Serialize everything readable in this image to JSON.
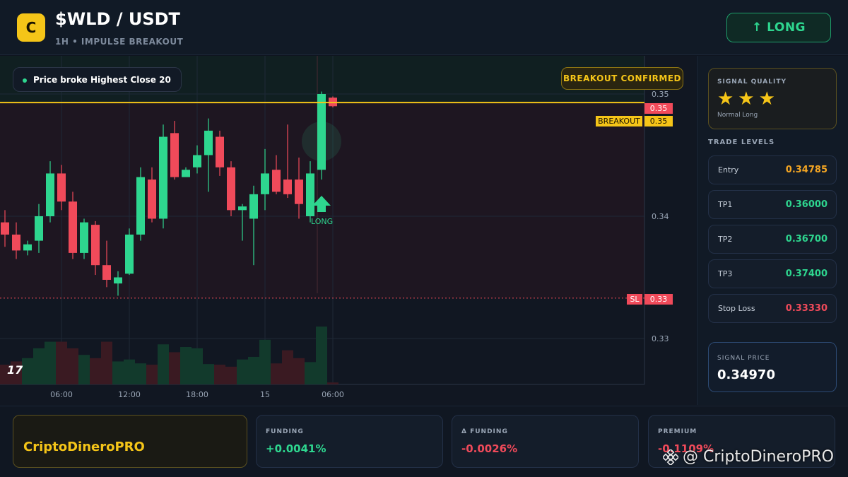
{
  "header": {
    "logo_letter": "C",
    "pair": "$WLD / USDT",
    "subtitle": "1H • IMPULSE BREAKOUT",
    "long_button": "↑ LONG"
  },
  "chart": {
    "pill_text": "Price broke Highest Close 20",
    "confirm_badge": "BREAKOUT CONFIRMED",
    "tv_logo": "17",
    "long_marker": "LONG",
    "breakout_tag": "BREAKOUT",
    "breakout_value": "0.35",
    "last_price_tag": "0.35",
    "sl_tag": "SL",
    "sl_value": "0.33",
    "y_ticks": [
      "0.35",
      "0.34",
      "0.33"
    ],
    "x_ticks": [
      "06:00",
      "12:00",
      "18:00",
      "15",
      "06:00"
    ]
  },
  "chart_data": {
    "type": "candlestick",
    "ylim": [
      0.3285,
      0.3555
    ],
    "y_ticks": [
      0.35,
      0.34,
      0.33
    ],
    "breakout_level": 0.3493,
    "stop_loss_level": 0.3333,
    "candles": [
      {
        "o": 0.3395,
        "h": 0.3405,
        "l": 0.3375,
        "c": 0.3385
      },
      {
        "o": 0.3385,
        "h": 0.3395,
        "l": 0.3365,
        "c": 0.3372
      },
      {
        "o": 0.3372,
        "h": 0.338,
        "l": 0.3368,
        "c": 0.3377
      },
      {
        "o": 0.338,
        "h": 0.341,
        "l": 0.337,
        "c": 0.34
      },
      {
        "o": 0.34,
        "h": 0.3445,
        "l": 0.3395,
        "c": 0.3435
      },
      {
        "o": 0.3435,
        "h": 0.3442,
        "l": 0.3405,
        "c": 0.3412
      },
      {
        "o": 0.3412,
        "h": 0.342,
        "l": 0.3365,
        "c": 0.337
      },
      {
        "o": 0.337,
        "h": 0.3398,
        "l": 0.3365,
        "c": 0.3395
      },
      {
        "o": 0.3393,
        "h": 0.3396,
        "l": 0.3352,
        "c": 0.336
      },
      {
        "o": 0.336,
        "h": 0.338,
        "l": 0.3342,
        "c": 0.3348
      },
      {
        "o": 0.3345,
        "h": 0.3355,
        "l": 0.3335,
        "c": 0.335
      },
      {
        "o": 0.3353,
        "h": 0.339,
        "l": 0.3352,
        "c": 0.3385
      },
      {
        "o": 0.3385,
        "h": 0.344,
        "l": 0.338,
        "c": 0.3432
      },
      {
        "o": 0.343,
        "h": 0.344,
        "l": 0.3395,
        "c": 0.3398
      },
      {
        "o": 0.3398,
        "h": 0.3475,
        "l": 0.339,
        "c": 0.3465
      },
      {
        "o": 0.3468,
        "h": 0.3478,
        "l": 0.343,
        "c": 0.3432
      },
      {
        "o": 0.3432,
        "h": 0.344,
        "l": 0.3433,
        "c": 0.3438
      },
      {
        "o": 0.344,
        "h": 0.3458,
        "l": 0.3435,
        "c": 0.345
      },
      {
        "o": 0.345,
        "h": 0.348,
        "l": 0.342,
        "c": 0.347
      },
      {
        "o": 0.3465,
        "h": 0.347,
        "l": 0.3433,
        "c": 0.344
      },
      {
        "o": 0.344,
        "h": 0.3445,
        "l": 0.34,
        "c": 0.3405
      },
      {
        "o": 0.3405,
        "h": 0.341,
        "l": 0.338,
        "c": 0.3408
      },
      {
        "o": 0.3398,
        "h": 0.3425,
        "l": 0.336,
        "c": 0.3418
      },
      {
        "o": 0.3418,
        "h": 0.3455,
        "l": 0.3405,
        "c": 0.3435
      },
      {
        "o": 0.3438,
        "h": 0.345,
        "l": 0.3418,
        "c": 0.342
      },
      {
        "o": 0.343,
        "h": 0.3475,
        "l": 0.3415,
        "c": 0.3418
      },
      {
        "o": 0.343,
        "h": 0.3448,
        "l": 0.3398,
        "c": 0.341
      },
      {
        "o": 0.34,
        "h": 0.3445,
        "l": 0.3395,
        "c": 0.3435
      },
      {
        "o": 0.3438,
        "h": 0.3502,
        "l": 0.343,
        "c": 0.35
      },
      {
        "o": 0.3497,
        "h": 0.3498,
        "l": 0.3489,
        "c": 0.349
      }
    ],
    "volumes": [
      3,
      3.5,
      4,
      5.5,
      6.5,
      6.5,
      5.5,
      4.5,
      4,
      6.5,
      3.5,
      3.8,
      3.2,
      3,
      6.1,
      4.9,
      5.7,
      5.5,
      3.1,
      3,
      2.7,
      3.8,
      4.2,
      6.8,
      3.2,
      5.2,
      4,
      3.4,
      8.8,
      0.3
    ]
  },
  "panel": {
    "signal_quality_title": "SIGNAL QUALITY",
    "stars": "★★★",
    "quality_note": "Normal Long",
    "trade_levels_title": "TRADE LEVELS",
    "levels": [
      {
        "label": "Entry",
        "value": "0.34785",
        "color": "#f5a623"
      },
      {
        "label": "TP1",
        "value": "0.36000",
        "color": "#2ed68f"
      },
      {
        "label": "TP2",
        "value": "0.36700",
        "color": "#2ed68f"
      },
      {
        "label": "TP3",
        "value": "0.37400",
        "color": "#2ed68f"
      },
      {
        "label": "Stop Loss",
        "value": "0.33330",
        "color": "#f04a5a"
      }
    ],
    "signal_price_title": "SIGNAL PRICE",
    "signal_price": "0.34970"
  },
  "footer": {
    "brand": "CriptoDineroPRO",
    "stats": [
      {
        "label": "FUNDING",
        "value": "+0.0041%",
        "color": "#2ed68f"
      },
      {
        "label": "Δ FUNDING",
        "value": "-0.0026%",
        "color": "#f04a5a"
      },
      {
        "label": "PREMIUM",
        "value": "-0.1109%",
        "color": "#f04a5a"
      }
    ],
    "watermark": "@ CriptoDineroPRO"
  },
  "colors": {
    "accent": "#f5c518",
    "up": "#2ed68f",
    "down": "#f04a5a",
    "background": "#0f1520"
  }
}
